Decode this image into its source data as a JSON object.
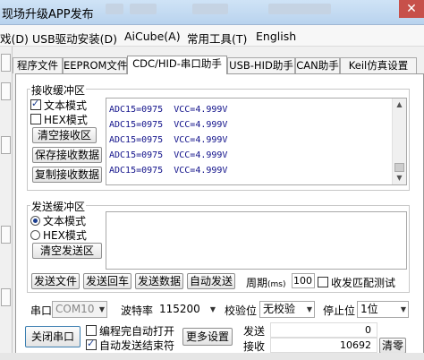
{
  "window": {
    "title": "现场升级APP发布"
  },
  "menu": {
    "items": [
      "戏(D)",
      "USB驱动安装(D)",
      "AiCube(A)",
      "常用工具(T)",
      "English"
    ]
  },
  "tabs": [
    "程序文件",
    "EEPROM文件",
    "CDC/HID-串口助手",
    "USB-HID助手",
    "CAN助手",
    "Keil仿真设置"
  ],
  "receive": {
    "label": "接收缓冲区",
    "text_mode": "文本模式",
    "hex_mode": "HEX模式",
    "clear_btn": "清空接收区",
    "save_btn": "保存接收数据",
    "copy_btn": "复制接收数据",
    "lines": [
      "ADC15=0975  VCC=4.999V",
      "ADC15=0975  VCC=4.999V",
      "ADC15=0975  VCC=4.999V",
      "ADC15=0975  VCC=4.999V",
      "ADC15=0975  VCC=4.999V"
    ]
  },
  "send": {
    "label": "发送缓冲区",
    "text_mode": "文本模式",
    "hex_mode": "HEX模式",
    "clear_btn": "清空发送区",
    "send_file_btn": "发送文件",
    "send_enter_btn": "发送回车",
    "send_data_btn": "发送数据",
    "auto_send_btn": "自动发送",
    "period_label": "周期",
    "period_unit": "(ms)",
    "period_value": "100",
    "echo_label": "收发匹配测试"
  },
  "port": {
    "port_label": "串口",
    "port_value": "COM10",
    "baud_label": "波特率",
    "baud_value": "115200",
    "parity_label": "校验位",
    "parity_value": "无校验",
    "stop_label": "停止位",
    "stop_value": "1位",
    "close_btn": "关闭串口",
    "auto_open": "编程完自动打开",
    "auto_end": "自动发送结束符",
    "more_btn": "更多设置",
    "sent_label": "发送",
    "sent_value": "0",
    "recv_label": "接收",
    "recv_value": "10692",
    "clear_count_btn": "清零"
  }
}
